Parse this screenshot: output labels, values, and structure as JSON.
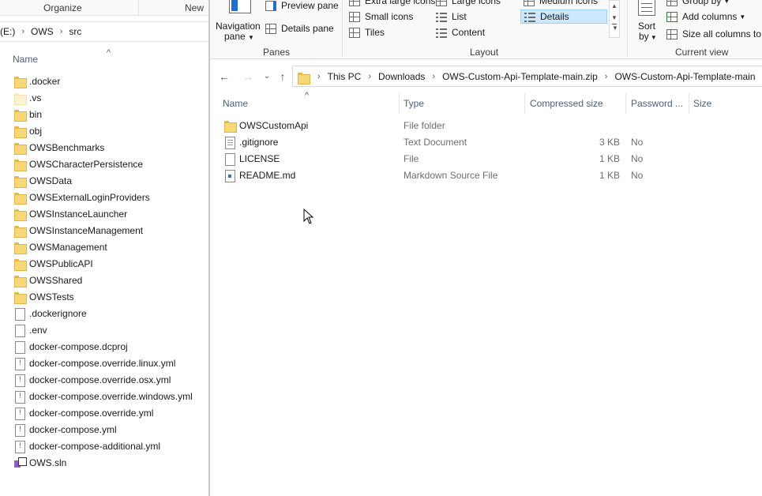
{
  "left_window": {
    "ribbon": {
      "organize_label": "Organize",
      "new_label": "New"
    },
    "address": {
      "drive": "(E:)",
      "crumbs": [
        "OWS",
        "src"
      ]
    },
    "column_name": "Name",
    "items": [
      {
        "name": ".docker",
        "icon": "folder-icon"
      },
      {
        "name": ".vs",
        "icon": "folder-icon"
      },
      {
        "name": "bin",
        "icon": "folder-icon"
      },
      {
        "name": "obj",
        "icon": "folder-icon"
      },
      {
        "name": "OWSBenchmarks",
        "icon": "folder-icon"
      },
      {
        "name": "OWSCharacterPersistence",
        "icon": "folder-icon"
      },
      {
        "name": "OWSData",
        "icon": "folder-icon"
      },
      {
        "name": "OWSExternalLoginProviders",
        "icon": "folder-icon"
      },
      {
        "name": "OWSInstanceLauncher",
        "icon": "folder-icon"
      },
      {
        "name": "OWSInstanceManagement",
        "icon": "folder-icon"
      },
      {
        "name": "OWSManagement",
        "icon": "folder-icon"
      },
      {
        "name": "OWSPublicAPI",
        "icon": "folder-icon"
      },
      {
        "name": "OWSShared",
        "icon": "folder-icon"
      },
      {
        "name": "OWSTests",
        "icon": "folder-icon"
      },
      {
        "name": ".dockerignore",
        "icon": "file-icon"
      },
      {
        "name": ".env",
        "icon": "file-icon"
      },
      {
        "name": "docker-compose.dcproj",
        "icon": "file-icon"
      },
      {
        "name": "docker-compose.override.linux.yml",
        "icon": "yml-icon"
      },
      {
        "name": "docker-compose.override.osx.yml",
        "icon": "yml-icon"
      },
      {
        "name": "docker-compose.override.windows.yml",
        "icon": "yml-icon"
      },
      {
        "name": "docker-compose.override.yml",
        "icon": "yml-icon"
      },
      {
        "name": "docker-compose.yml",
        "icon": "yml-icon"
      },
      {
        "name": "docker-compose-additional.yml",
        "icon": "yml-icon"
      },
      {
        "name": "OWS.sln",
        "icon": "sln-icon"
      }
    ]
  },
  "ribbon": {
    "panes": {
      "group_label": "Panes",
      "navigation_pane_line1": "Navigation",
      "navigation_pane_line2": "pane",
      "preview_pane": "Preview pane",
      "details_pane": "Details pane"
    },
    "layout": {
      "group_label": "Layout",
      "extra_large_icons": "Extra large icons",
      "large_icons": "Large icons",
      "medium_icons": "Medium icons",
      "small_icons": "Small icons",
      "list": "List",
      "details": "Details",
      "tiles": "Tiles",
      "content": "Content"
    },
    "current_view": {
      "group_label": "Current view",
      "sort_by_line1": "Sort",
      "sort_by_line2": "by",
      "group_by": "Group by",
      "add_columns": "Add columns",
      "size_all_columns": "Size all columns to fit"
    }
  },
  "address": {
    "crumbs": [
      "This PC",
      "Downloads",
      "OWS-Custom-Api-Template-main.zip",
      "OWS-Custom-Api-Template-main"
    ]
  },
  "columns": {
    "name": "Name",
    "type": "Type",
    "compressed_size": "Compressed size",
    "password": "Password ...",
    "size": "Size"
  },
  "files": [
    {
      "name": "OWSCustomApi",
      "type": "File folder",
      "compressed_size": "",
      "password": "",
      "icon": "folder-icon"
    },
    {
      "name": ".gitignore",
      "type": "Text Document",
      "compressed_size": "3 KB",
      "password": "No",
      "icon": "doc-icon"
    },
    {
      "name": "LICENSE",
      "type": "File",
      "compressed_size": "1 KB",
      "password": "No",
      "icon": "file-icon"
    },
    {
      "name": "README.md",
      "type": "Markdown Source File",
      "compressed_size": "1 KB",
      "password": "No",
      "icon": "md-icon"
    }
  ]
}
